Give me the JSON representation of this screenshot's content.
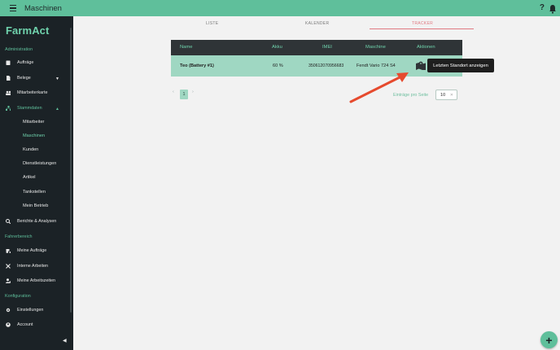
{
  "app": {
    "title": "Maschinen"
  },
  "sidebar": {
    "brand": "FarmAct",
    "sections": {
      "admin": "Administration",
      "fahrer": "Fahrerbereich",
      "konfig": "Konfiguration"
    },
    "items": {
      "auftraege": "Aufträge",
      "belege": "Belege",
      "mitarbeiterkarte": "Mitarbeiterkarte",
      "stammdaten": "Stammdaten",
      "berichte": "Berichte & Analysen",
      "meine_auftraege": "Meine Aufträge",
      "interne_arbeiten": "Interne Arbeiten",
      "meine_arbeitszeiten": "Meine Arbeitszeiten",
      "einstellungen": "Einstellungen",
      "account": "Account"
    },
    "stammdaten_sub": [
      "Mitarbeiter",
      "Maschinen",
      "Kunden",
      "Dienstleistungen",
      "Artikel",
      "Tankstellen",
      "Mein Betrieb"
    ]
  },
  "tabs": [
    "LISTE",
    "KALENDER",
    "TRACKER"
  ],
  "table": {
    "headers": [
      "Name",
      "Akku",
      "IMEI",
      "Maschine",
      "Aktionen"
    ],
    "rows": [
      {
        "name": "Teo (Battery #1)",
        "akku": "60 %",
        "imei": "350612070956683",
        "maschine": "Fendt Vario 724 S4"
      }
    ]
  },
  "tooltip": "Letzten Standort anzeigen",
  "pagination": {
    "prev": "‹",
    "current": "1",
    "next": "›",
    "per_page_label": "Einträge pro Seite",
    "per_page_value": "10"
  },
  "fab_label": "+",
  "colors": {
    "accent": "#5fbf9b",
    "sidebar": "#1b2226",
    "row": "#9fd7c2",
    "arrow": "#e64a2e"
  }
}
